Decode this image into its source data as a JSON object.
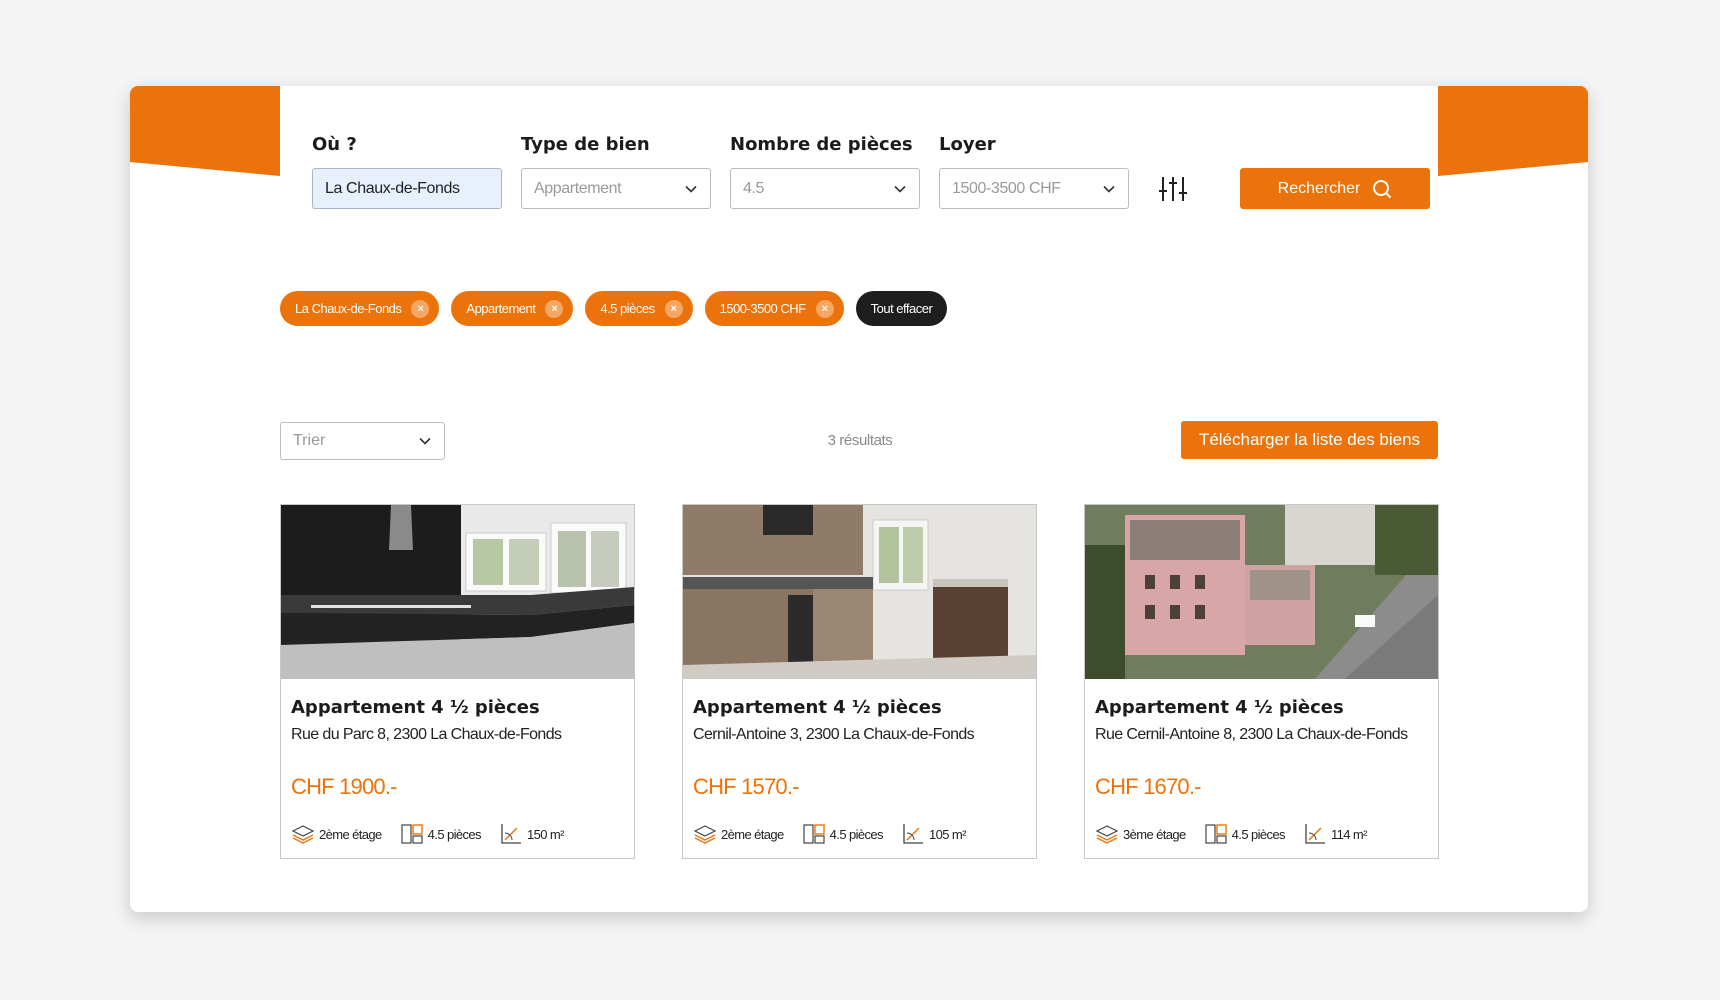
{
  "brand": {
    "accent": "#ec730b",
    "dark": "#1e1e1e"
  },
  "search": {
    "where_label": "Où ?",
    "where_value": "La Chaux-de-Fonds",
    "type_label": "Type de bien",
    "type_value": "Appartement",
    "rooms_label": "Nombre de pièces",
    "rooms_value": "4.5",
    "rent_label": "Loyer",
    "rent_value": "1500-3500 CHF",
    "filters_icon": "sliders-icon",
    "search_button": "Rechercher"
  },
  "chips": [
    {
      "label": "La Chaux-de-Fonds"
    },
    {
      "label": "Appartement"
    },
    {
      "label": "4.5 pièces"
    },
    {
      "label": "1500-3500 CHF"
    }
  ],
  "clear_all": "Tout effacer",
  "toolbar": {
    "sort_placeholder": "Trier",
    "results_count": "3 résultats",
    "download_button": "Télécharger la liste des biens"
  },
  "listings": [
    {
      "title": "Appartement 4 ½ pièces",
      "address": "Rue du Parc 8, 2300 La Chaux-de-Fonds",
      "price": "CHF 1900.-",
      "floor": "2ème étage",
      "rooms": "4.5 pièces",
      "area": "150 m²"
    },
    {
      "title": "Appartement 4 ½ pièces",
      "address": "Cernil-Antoine 3, 2300 La Chaux-de-Fonds",
      "price": "CHF 1570.-",
      "floor": "2ème étage",
      "rooms": "4.5 pièces",
      "area": "105 m²"
    },
    {
      "title": "Appartement 4 ½ pièces",
      "address": "Rue Cernil-Antoine 8, 2300 La Chaux-de-Fonds",
      "price": "CHF 1670.-",
      "floor": "3ème étage",
      "rooms": "4.5 pièces",
      "area": "114 m²"
    }
  ]
}
